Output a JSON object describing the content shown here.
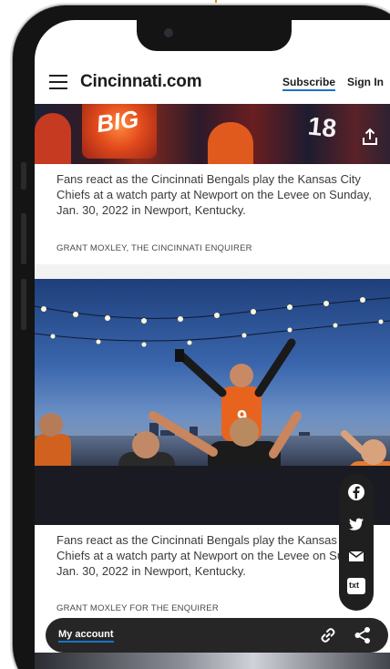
{
  "header": {
    "logo": "Cincinnati.com",
    "subscribe_label": "Subscribe",
    "signin_label": "Sign In"
  },
  "gallery": {
    "items": [
      {
        "photo_text": "BIG",
        "jersey_number": "18",
        "caption": "Fans react as the Cincinnati Bengals play the Kansas City Chiefs at a watch party at Newport on the Levee on Sunday, Jan. 30, 2022 in Newport, Kentucky.",
        "credit": "GRANT MOXLEY, THE CINCINNATI ENQUIRER"
      },
      {
        "caption": "Fans react as the Cincinnati Bengals play the Kansas City Chiefs at a watch party at Newport on the Levee on Sunday, Jan. 30, 2022 in Newport, Kentucky.",
        "credit": "GRANT MOXLEY FOR THE ENQUIRER"
      }
    ]
  },
  "share_rail": {
    "items": [
      "facebook-icon",
      "twitter-icon",
      "email-icon",
      "text-message-icon"
    ],
    "text_label": "txt"
  },
  "bottom_bar": {
    "account_label": "My account",
    "icons": [
      "link-icon",
      "share-icon"
    ]
  },
  "colors": {
    "link_underline": "#1a73c8",
    "frame": "#141414",
    "bar_bg": "#262626"
  }
}
